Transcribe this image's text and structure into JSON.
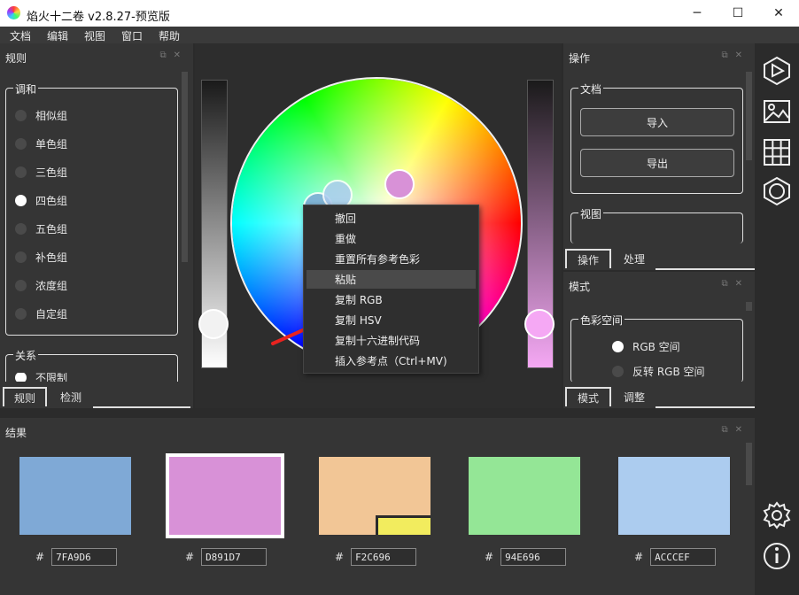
{
  "window": {
    "title": "焰火十二卷 v2.8.27-预览版",
    "minimize": "─",
    "maximize": "☐",
    "close": "✕"
  },
  "menu": [
    "文档",
    "编辑",
    "视图",
    "窗口",
    "帮助"
  ],
  "rules_panel": {
    "title": "规则",
    "harmony_group": "调和",
    "options": [
      "相似组",
      "单色组",
      "三色组",
      "四色组",
      "五色组",
      "补色组",
      "浓度组",
      "自定组"
    ],
    "selected_index": 3,
    "relation_group": "关系",
    "relation_option": "不限制",
    "tabs": [
      "规则",
      "检测"
    ]
  },
  "ops_panel": {
    "title": "操作",
    "doc_group": "文档",
    "import_label": "导入",
    "export_label": "导出",
    "view_group": "视图",
    "tabs": [
      "操作",
      "处理"
    ]
  },
  "mode_panel": {
    "title": "模式",
    "color_space_group": "色彩空间",
    "options": [
      "RGB 空间",
      "反转 RGB 空间"
    ],
    "selected_index": 0,
    "tabs": [
      "模式",
      "调整"
    ]
  },
  "context_menu": {
    "items": [
      "撤回",
      "重做",
      "重置所有参考色彩",
      "粘贴",
      "复制 RGB",
      "复制 HSV",
      "复制十六进制代码",
      "插入参考点（Ctrl+MV)"
    ],
    "hover_index": 3
  },
  "results": {
    "title": "结果",
    "swatches": [
      {
        "hex": "7FA9D6",
        "color": "#7FA9D6"
      },
      {
        "hex": "D891D7",
        "color": "#D891D7"
      },
      {
        "hex": "F2C696",
        "color": "#F2C696"
      },
      {
        "hex": "94E696",
        "color": "#94E696"
      },
      {
        "hex": "ACCCEF",
        "color": "#ACCCEF"
      }
    ],
    "selected_index": 1,
    "hash": "#"
  },
  "colors": {
    "accent_arrow": "#e8231f",
    "warning_badge": "#f2ec5e"
  }
}
